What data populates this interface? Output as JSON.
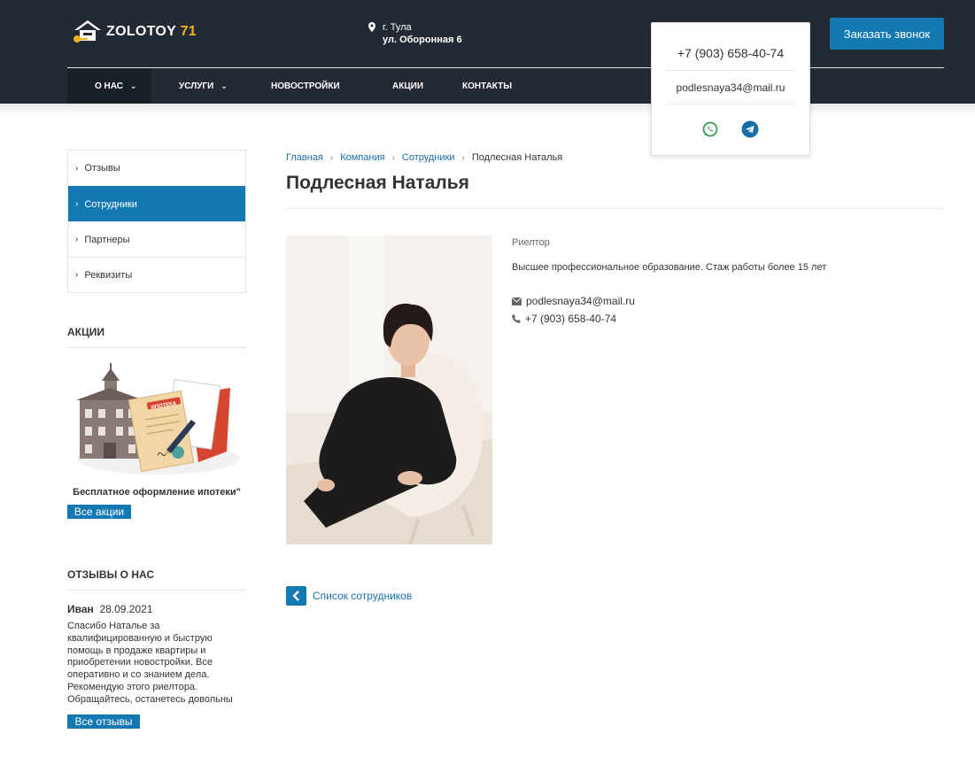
{
  "header": {
    "logo_text": "ZOLOTOY",
    "logo_number": "71",
    "city": "г. Тула",
    "address": "ул. Оборонная 6",
    "call_button": "Заказать звонок",
    "brand_color": "#1479b3",
    "header_bg": "#232a33"
  },
  "nav": {
    "items": [
      {
        "label": "О нас",
        "has_dropdown": true,
        "active": true
      },
      {
        "label": "Услуги",
        "has_dropdown": true,
        "active": false
      },
      {
        "label": "Новостройки",
        "has_dropdown": false,
        "active": false
      },
      {
        "label": "Акции",
        "has_dropdown": false,
        "active": false
      },
      {
        "label": "Контакты",
        "has_dropdown": false,
        "active": false
      }
    ]
  },
  "popup": {
    "phone": "+7 (903) 658-40-74",
    "email": "podlesnaya34@mail.ru",
    "social": [
      "whatsapp-icon",
      "telegram-icon"
    ]
  },
  "sidebar": {
    "menu": [
      {
        "label": "Отзывы",
        "active": false
      },
      {
        "label": "Сотрудники",
        "active": true
      },
      {
        "label": "Партнеры",
        "active": false
      },
      {
        "label": "Реквизиты",
        "active": false
      }
    ],
    "promo": {
      "heading": "Акции",
      "caption": "Бесплатное оформление ипотеки\"",
      "button": "Все акции",
      "image_label": "ИПОТЕКА"
    },
    "reviews": {
      "heading": "Отзывы о нас",
      "author": "Иван",
      "date": "28.09.2021",
      "text": "Спасибо Наталье за квалифицированную и быструю помощь в продаже квартиры и приобретении новостройки. Все оперативно и со знанием дела. Рекомендую этого риелтора. Обращайтесь, останетесь довольны",
      "button": "Все отзывы"
    }
  },
  "main": {
    "breadcrumbs": [
      "Главная",
      "Компания",
      "Сотрудники",
      "Подлесная Наталья"
    ],
    "title": "Подлесная Наталья",
    "position": "Риелтор",
    "description": "Высшее профессиональное образование. Стаж работы более 15 лет",
    "email": "podlesnaya34@mail.ru",
    "phone": "+7 (903) 658-40-74",
    "back_link": "Список сотрудников"
  }
}
